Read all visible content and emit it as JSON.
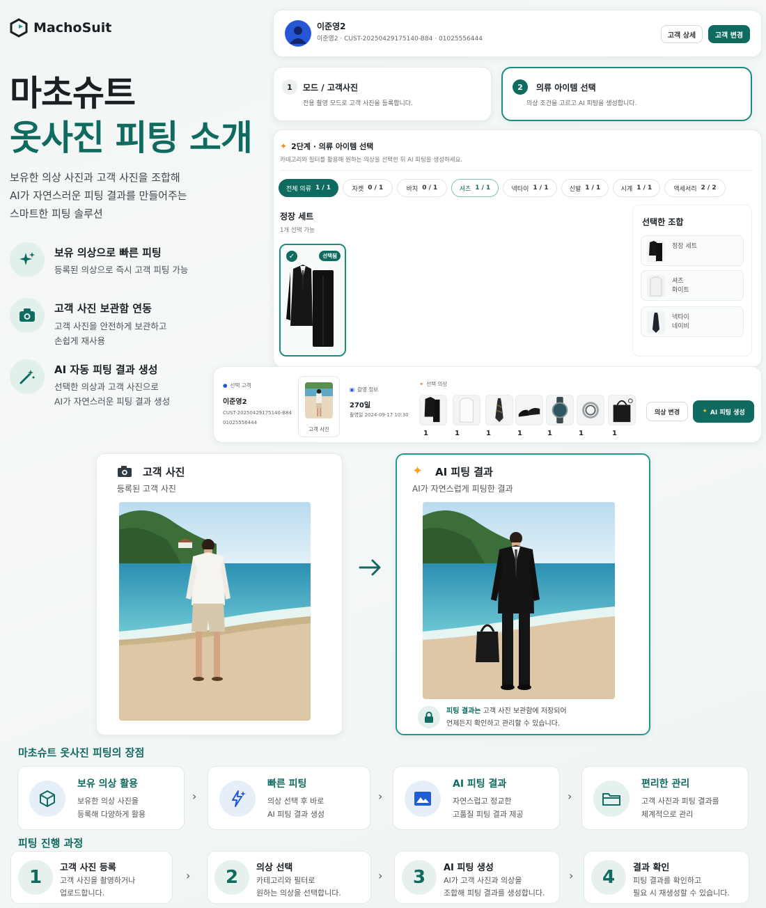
{
  "brand": {
    "name": "MachoSuit"
  },
  "hero": {
    "title_line1": "마초슈트",
    "title_line2": "옷사진 피팅 소개",
    "desc_line1": "보유한 의상 사진과 고객 사진을 조합해",
    "desc_line2": "AI가 자연스러운 피팅 결과를 만들어주는",
    "desc_line3": "스마트한 피팅 솔루션"
  },
  "features": [
    {
      "title": "보유 의상으로 빠른 피팅",
      "desc1": "등록된 의상으로 즉시 고객 피팅 가능",
      "desc2": "",
      "icon": "sparkles-icon"
    },
    {
      "title": "고객 사진 보관함 연동",
      "desc1": "고객 사진을 안전하게 보관하고",
      "desc2": "손쉽게 재사용",
      "icon": "camera-icon"
    },
    {
      "title": "AI 자동 피팅 결과 생성",
      "desc1": "선택한 의상과 고객 사진으로",
      "desc2": "AI가 자연스러운 피팅 결과 생성",
      "icon": "magic-wand-icon"
    }
  ],
  "customer_bar": {
    "name": "이준영2",
    "meta": "이준영2 · CUST-20250429175140-B84 · 01025556444",
    "detail_btn": "고객 상세",
    "change_btn": "고객 변경"
  },
  "steps_top": [
    {
      "num": "1",
      "title": "모드 / 고객사진",
      "desc": "전용 촬영 모드로 고객 사진을 등록합니다."
    },
    {
      "num": "2",
      "title": "의류 아이템 선택",
      "desc": "의상 조건을 고르고 AI 피팅을 생성합니다."
    }
  ],
  "selection": {
    "heading": "2단계 · 의류 아이템 선택",
    "sub": "카테고리와 필터를 활용해 원하는 의상을 선택한 뒤 AI 피팅을 생성하세요.",
    "tabs": [
      {
        "label": "전체 의류",
        "count": "1 / 1"
      },
      {
        "label": "자켓",
        "count": "0 / 1"
      },
      {
        "label": "바지",
        "count": "0 / 1"
      },
      {
        "label": "셔츠",
        "count": "1 / 1"
      },
      {
        "label": "넥타이",
        "count": "1 / 1"
      },
      {
        "label": "신발",
        "count": "1 / 1"
      },
      {
        "label": "시계",
        "count": "1 / 1"
      },
      {
        "label": "액세서리",
        "count": "2 / 2"
      }
    ],
    "section_title": "정장 세트",
    "section_sub": "1개 선택 가능",
    "selected_badge": "선택됨",
    "combo_title": "선택한 조합",
    "combo": [
      {
        "line1": "정장 세트",
        "line2": ""
      },
      {
        "line1": "셔츠",
        "line2": "화이트"
      },
      {
        "line1": "넥타이",
        "line2": "네이비"
      }
    ]
  },
  "summary": {
    "customer_label": "선택 고객",
    "customer_name": "이준영2",
    "customer_id": "CUST-20250429175140-B84",
    "customer_phone": "01025556444",
    "photo_caption": "고객 사진",
    "shoot_label": "촬영 정보",
    "shoot_value": "270일",
    "shoot_date": "촬영일 2024-09-17 10:30",
    "outfit_label": "선택 의상",
    "counts": [
      "1",
      "1",
      "1",
      "1",
      "1",
      "1",
      "1"
    ],
    "change_btn": "의상 변경",
    "generate_btn": "AI 피팅 생성"
  },
  "compare": {
    "left_title": "고객 사진",
    "left_sub": "등록된 고객 사진",
    "right_title": "AI 피팅 결과",
    "right_sub": "AI가 자연스럽게 피팅한 결과",
    "note_bold": "피팅 결과는",
    "note_line1": " 고객 사진 보관함에 저장되어",
    "note_line2": "언제든지 확인하고 관리할 수 있습니다."
  },
  "advantages": {
    "title": "마초슈트 옷사진 피팅의 장점",
    "items": [
      {
        "title": "보유 의상 활용",
        "d1": "보유한 의상 사진을",
        "d2": "등록해 다양하게 활용"
      },
      {
        "title": "빠른 피팅",
        "d1": "의상 선택 후 바로",
        "d2": "AI 피팅 결과 생성"
      },
      {
        "title": "AI 피팅 결과",
        "d1": "자연스럽고 정교한",
        "d2": "고품질 피팅 결과 제공"
      },
      {
        "title": "편리한 관리",
        "d1": "고객 사진과 피팅 결과를",
        "d2": "체계적으로 관리"
      }
    ]
  },
  "process": {
    "title": "피팅 진행 과정",
    "items": [
      {
        "num": "1",
        "title": "고객 사진 등록",
        "d1": "고객 사진을 촬영하거나",
        "d2": "업로드합니다."
      },
      {
        "num": "2",
        "title": "의상 선택",
        "d1": "카테고리와 필터로",
        "d2": "원하는 의상을 선택합니다."
      },
      {
        "num": "3",
        "title": "AI 피팅 생성",
        "d1": "AI가 고객 사진과 의상을",
        "d2": "조합해 피팅 결과를 생성합니다."
      },
      {
        "num": "4",
        "title": "결과 확인",
        "d1": "피팅 결과를 확인하고",
        "d2": "필요 시 재생성할 수 있습니다."
      }
    ]
  },
  "colors": {
    "accent": "#0f6b60",
    "bg": "#f3f7f6"
  }
}
